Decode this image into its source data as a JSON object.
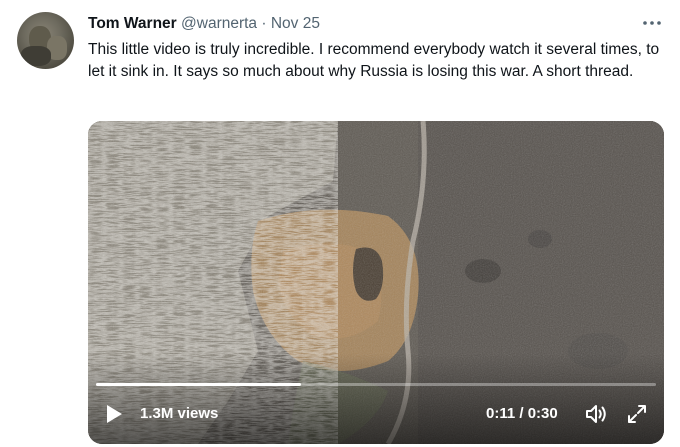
{
  "tweet": {
    "author_name": "Tom Warner",
    "handle": "@warnerta",
    "separator": "·",
    "date": "Nov 25",
    "more_icon": "more-horizontal-icon",
    "text": "This little video is truly incredible. I recommend everybody watch it several times, to let it sink in. It says so much about why Russia is losing this war. A short thread."
  },
  "video": {
    "views": "1.3M views",
    "time": "0:11 / 0:30",
    "progress": 0.3667,
    "icons": [
      "play-icon",
      "volume-icon",
      "expand-icon"
    ]
  }
}
